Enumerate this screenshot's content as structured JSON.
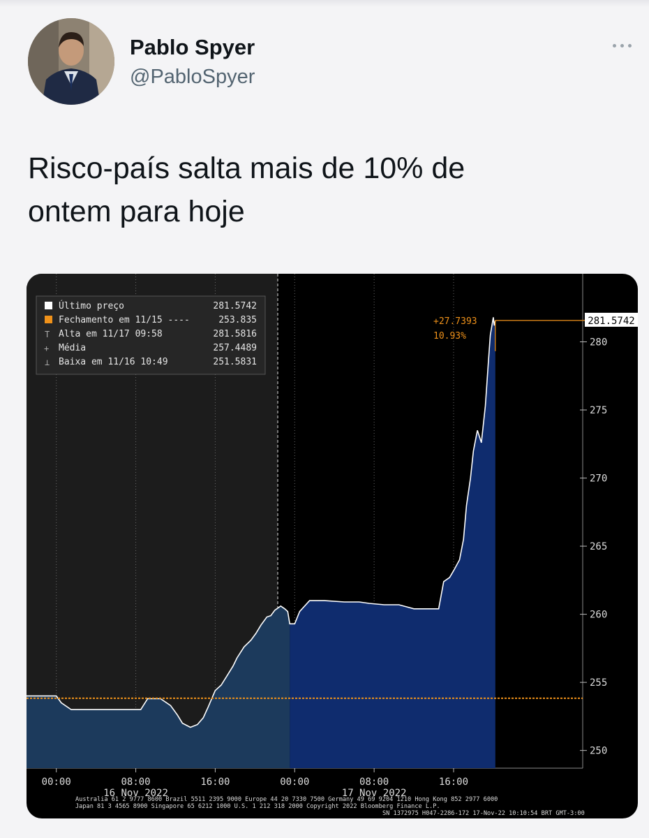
{
  "tweet": {
    "author_name": "Pablo Spyer",
    "author_handle": "@PabloSpyer",
    "text_line1": "Risco-país salta mais de 10% de",
    "text_line2": "ontem para hoje"
  },
  "colors": {
    "accent_orange": "#f0921a",
    "area_fill": "#1c3a5c",
    "area_fill_today": "#0f2c6e",
    "handle_gray": "#536471"
  },
  "legend": {
    "rows": [
      {
        "label": "Último preço",
        "value": "281.5742"
      },
      {
        "label": "Fechamento em 11/15 ----",
        "value": "253.835"
      },
      {
        "label": "Alta em 11/17 09:58",
        "value": "281.5816"
      },
      {
        "label": "Média",
        "value": "257.4489"
      },
      {
        "label": "Baixa em 11/16 10:49",
        "value": "251.5831"
      }
    ]
  },
  "annotation": {
    "change": "+27.7393",
    "pct": "10.93%",
    "last_price_tag": "281.5742"
  },
  "footer": {
    "line1": "Australia 61 2 9777 8600 Brazil 5511 2395 9000 Europe 44 20 7330 7500 Germany 49 69 9204 1210 Hong Kong 852 2977 6000",
    "line2": "Japan 81 3 4565 8900          Singapore 65 6212 1000        U.S. 1 212 318 2000          Copyright 2022 Bloomberg Finance L.P.",
    "line3": "SN 1372975 H047-2286-172 17-Nov-22 10:10:54 BRT  GMT-3:00"
  },
  "chart_data": {
    "type": "area",
    "title": "",
    "xlabel": "",
    "ylabel": "",
    "ylim": [
      248.7,
      285
    ],
    "y_ticks": [
      250,
      255,
      260,
      265,
      270,
      275,
      280
    ],
    "x_tick_labels": [
      "00:00",
      "08:00",
      "16:00",
      "00:00",
      "08:00",
      "16:00"
    ],
    "date_labels": [
      "16 Nov 2022",
      "17 Nov 2022"
    ],
    "reference_line": {
      "name": "Fechamento em 11/15",
      "value": 253.835
    },
    "series": [
      {
        "name": "Último preço",
        "x_hours": [
          -3,
          0,
          0.5,
          1.5,
          2.5,
          8.5,
          9.2,
          10.5,
          11.5,
          12.2,
          12.7,
          13.5,
          14.2,
          14.8,
          15.3,
          16.0,
          16.6,
          17.2,
          17.8,
          18.2,
          18.9,
          19.6,
          20.1,
          20.6,
          21.2,
          21.6,
          22.0,
          22.6,
          23.0,
          23.3,
          23.5,
          23.5,
          24.0,
          24.5,
          25.5,
          27.0,
          29.0,
          30.5,
          31.5,
          33.0,
          34.5,
          36.0,
          37.0,
          38.5,
          39.0,
          39.6,
          40.0,
          40.6,
          41.0,
          41.3,
          41.7,
          42.0,
          42.4,
          42.8,
          43.2,
          43.5,
          43.7,
          44.0,
          44.1,
          44.2
        ],
        "values": [
          254.0,
          254.0,
          253.5,
          253.0,
          253.0,
          253.0,
          253.8,
          253.8,
          253.3,
          252.6,
          252.0,
          251.7,
          251.9,
          252.4,
          253.2,
          254.4,
          254.8,
          255.5,
          256.2,
          256.8,
          257.6,
          258.1,
          258.6,
          259.2,
          259.8,
          259.9,
          260.3,
          260.6,
          260.4,
          260.2,
          259.3,
          259.3,
          259.3,
          260.2,
          261.0,
          261.0,
          260.9,
          260.9,
          260.8,
          260.7,
          260.7,
          260.4,
          260.4,
          260.4,
          262.4,
          262.7,
          263.2,
          264.0,
          265.5,
          268.0,
          270.0,
          272.0,
          273.5,
          272.6,
          275.3,
          278.5,
          280.5,
          281.8,
          281.2,
          281.57
        ]
      }
    ]
  }
}
